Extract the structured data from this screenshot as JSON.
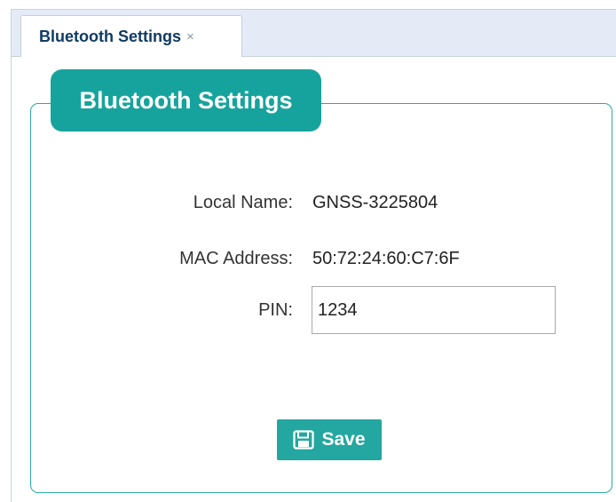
{
  "tab": {
    "label": "Bluetooth Settings",
    "close_glyph": "×"
  },
  "panel": {
    "title": "Bluetooth Settings"
  },
  "fields": {
    "local_name": {
      "label": "Local Name:",
      "value": "GNSS-3225804"
    },
    "mac_address": {
      "label": "MAC Address:",
      "value": "50:72:24:60:C7:6F"
    },
    "pin": {
      "label": "PIN:",
      "value": "1234"
    }
  },
  "save_button": {
    "label": "Save",
    "icon": "save-icon"
  },
  "colors": {
    "accent": "#17a39d",
    "tab_text": "#0f3b63",
    "tabbar_bg": "#e4ebf6"
  }
}
